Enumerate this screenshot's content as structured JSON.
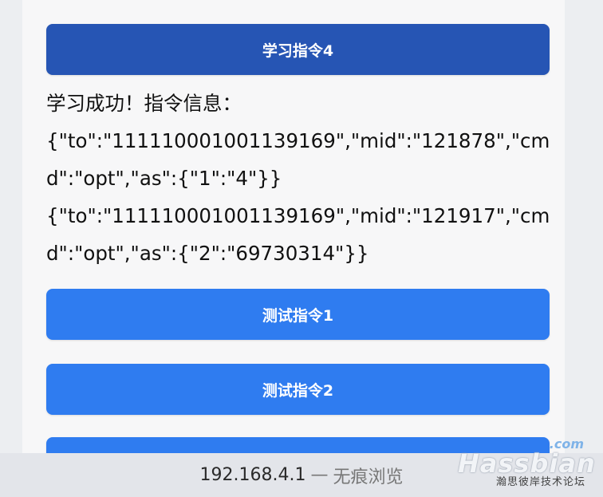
{
  "buttons": {
    "learn4": "学习指令4",
    "test1": "测试指令1",
    "test2": "测试指令2"
  },
  "result": {
    "heading": "学习成功！指令信息：",
    "line1": "{\"to\":\"111110001001139169\",\"mid\":\"121878\",\"cmd\":\"opt\",\"as\":{\"1\":\"4\"}}",
    "line2": "{\"to\":\"111110001001139169\",\"mid\":\"121917\",\"cmd\":\"opt\",\"as\":{\"2\":\"69730314\"}}"
  },
  "browser_bar": {
    "address": "192.168.4.1",
    "separator": "—",
    "mode": "无痕浏览"
  },
  "watermark": {
    "domain_suffix": ".com",
    "brand": "Hassbian",
    "subtitle": "瀚思彼岸技术论坛"
  },
  "colors": {
    "learn_button": "#2655b4",
    "test_button": "#2f7cf0"
  }
}
